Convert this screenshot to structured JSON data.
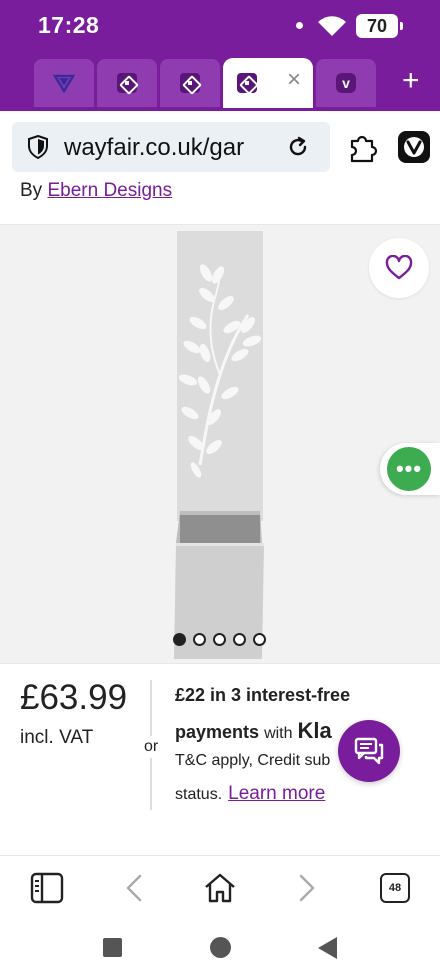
{
  "status_bar": {
    "time": "17:28",
    "battery_level": "70"
  },
  "tabs": [
    {
      "icon": "ryanair-icon",
      "active": false
    },
    {
      "icon": "wayfair-icon",
      "active": false
    },
    {
      "icon": "wayfair-icon",
      "active": false
    },
    {
      "icon": "wayfair-icon",
      "active": true
    },
    {
      "icon": "vivaldi-icon",
      "active": false
    }
  ],
  "tab_close_glyph": "×",
  "new_tab_glyph": "+",
  "address_bar": {
    "url": "wayfair.co.uk/gar"
  },
  "product": {
    "byline_prefix": "By",
    "brand": "Ebern Designs",
    "image_count": 5,
    "image_index": 0,
    "price": "£63.99",
    "vat_note": "incl. VAT",
    "or_label": "or",
    "installment_line": "£22 in 3 interest-free",
    "payments_word": "payments",
    "with_word": "with",
    "klarna_partial": "Kla",
    "klarna_tail": "+,",
    "terms_line": "T&C apply, Credit sub",
    "terms_tail": "status.",
    "learn_more": "Learn more"
  },
  "bottom_bar": {
    "tab_count": "48"
  },
  "colors": {
    "brand_purple": "#7a1d9c",
    "chat_green": "#3dab4f"
  }
}
